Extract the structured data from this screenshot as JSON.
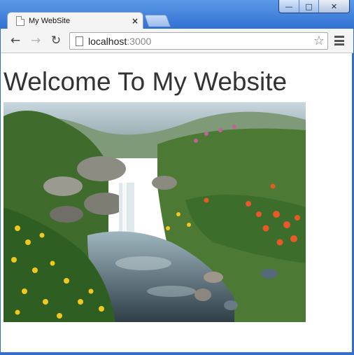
{
  "browser": {
    "tab": {
      "title": "My WebSite",
      "close": "×"
    },
    "address": {
      "host": "localhost",
      "port": ":3000"
    },
    "nav": {
      "back": "←",
      "forward": "→",
      "reload": "↻"
    },
    "window_controls": {
      "minimize": "—",
      "maximize": "□",
      "close": "✕"
    }
  },
  "page": {
    "heading": "Welcome To My Website",
    "image": "waterfall-garden-photo"
  },
  "colors": {
    "frame": "#2e6fd0",
    "toolbar": "#f4f4f4",
    "heading_text": "#333333"
  }
}
